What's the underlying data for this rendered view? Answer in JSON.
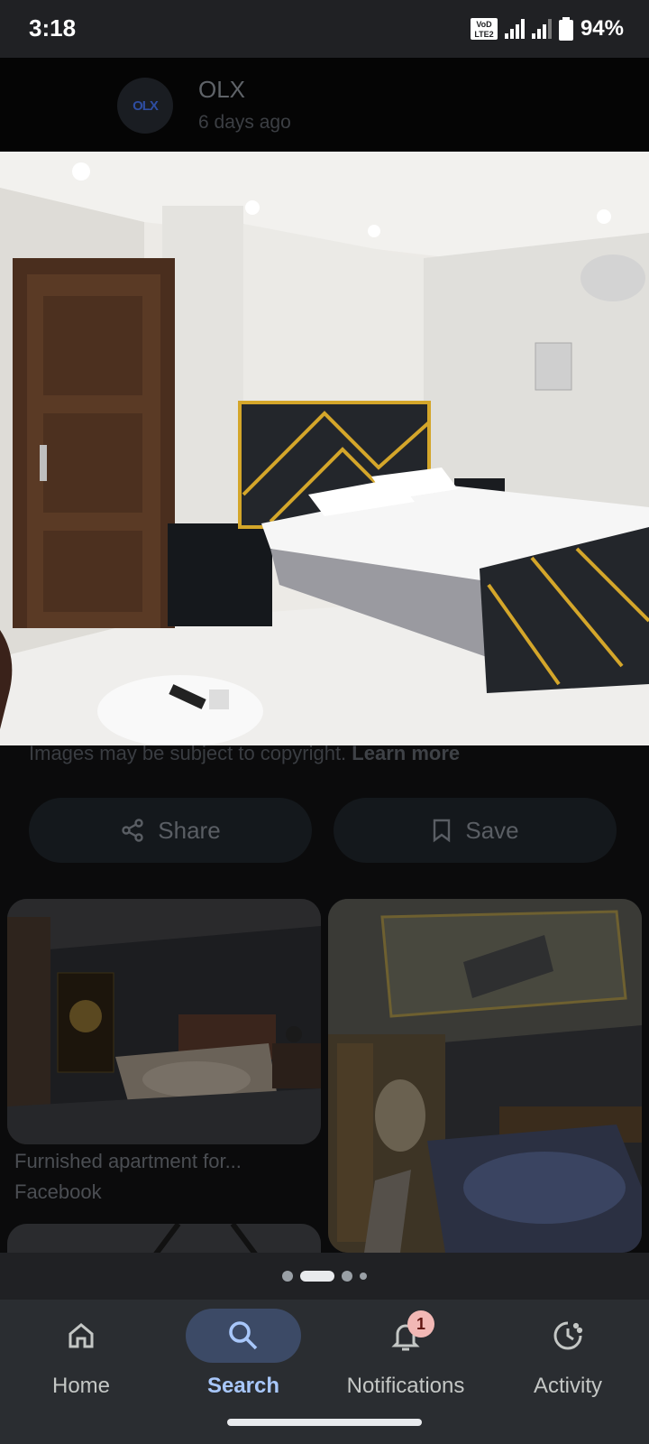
{
  "status_bar": {
    "time": "3:18",
    "network": "VoLTE 4G",
    "battery": "94%"
  },
  "source": {
    "logo_text": "OLX",
    "name": "OLX",
    "age": "6 days ago"
  },
  "copyright": {
    "text": "Images may be subject to copyright.",
    "link": "Learn more"
  },
  "actions": {
    "share": "Share",
    "save": "Save"
  },
  "results": [
    {
      "title": "Furnished apartment for...",
      "source": "Facebook"
    }
  ],
  "pager": {
    "count": 4,
    "active": 1
  },
  "nav": {
    "home": "Home",
    "search": "Search",
    "notifications": "Notifications",
    "notifications_badge": "1",
    "activity": "Activity"
  },
  "colors": {
    "accent": "#a8c7fa",
    "badge": "#f2b8b5",
    "nav_bg": "#2a2d31"
  }
}
